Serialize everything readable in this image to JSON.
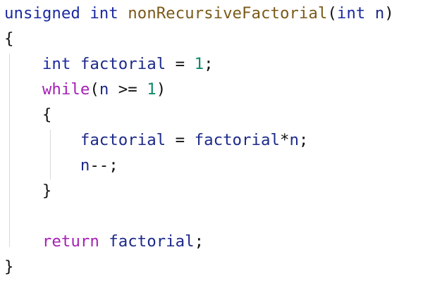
{
  "colors": {
    "background": "#ffffff",
    "type_keyword": "#1b2aa3",
    "control_keyword": "#a51fb5",
    "function_name": "#7a5a1a",
    "number_literal": "#0f8a6a",
    "identifier": "#1d2a8a",
    "punctuation": "#111111",
    "indent_guide": "#d9d9d9"
  },
  "code": {
    "signature": {
      "return_type_1": "unsigned",
      "return_type_2": "int",
      "function_name": "nonRecursiveFactorial",
      "open_paren": "(",
      "param_type": "int",
      "param_name": "n",
      "close_paren": ")"
    },
    "open_brace": "{",
    "decl": {
      "type": "int",
      "name": "factorial",
      "op": "=",
      "value": "1",
      "semi": ";"
    },
    "while_stmt": {
      "keyword": "while",
      "open_paren": "(",
      "var": "n",
      "op": ">=",
      "value": "1",
      "close_paren": ")"
    },
    "loop_open_brace": "{",
    "assign": {
      "lhs": "factorial",
      "op": "=",
      "rhs_1": "factorial",
      "mul": "*",
      "rhs_2": "n",
      "semi": ";"
    },
    "decrement": {
      "var": "n",
      "op": "--",
      "semi": ";"
    },
    "loop_close_brace": "}",
    "return_stmt": {
      "keyword": "return",
      "value": "factorial",
      "semi": ";"
    },
    "close_brace": "}"
  }
}
